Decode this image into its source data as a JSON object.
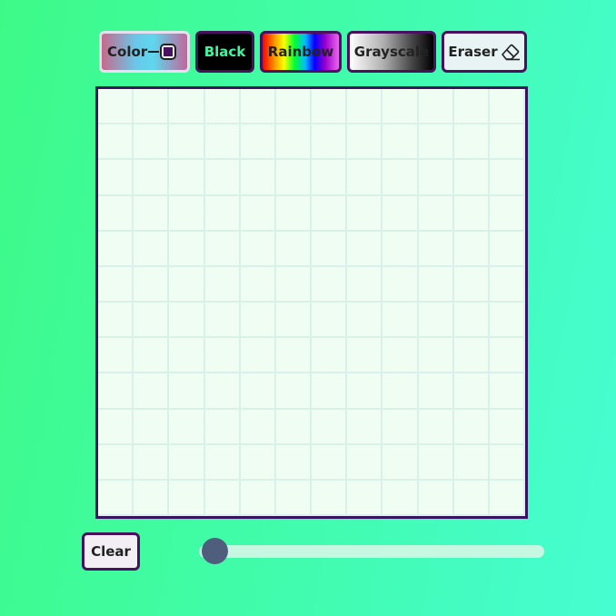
{
  "toolbar": {
    "color_label": "Color",
    "black_label": "Black",
    "rainbow_label": "Rainbow",
    "grayscale_label": "Grayscale",
    "eraser_label": "Eraser",
    "picked_color": "#4a1060"
  },
  "grid": {
    "rows": 12,
    "cols": 12
  },
  "controls": {
    "clear_label": "Clear",
    "size_slider_value": 0
  },
  "colors": {
    "accent": "#4a1060",
    "grid_background": "#f0fdf2",
    "black_button_text": "#41f5a0"
  }
}
